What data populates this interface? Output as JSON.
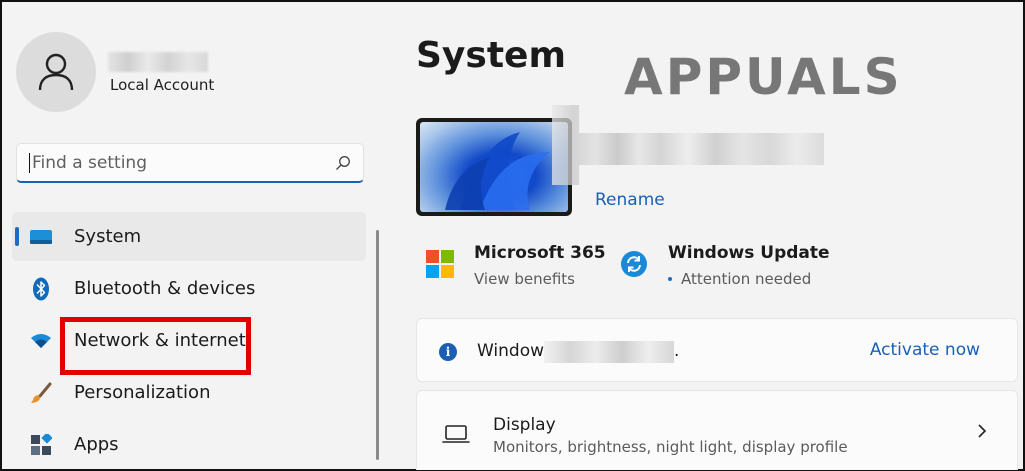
{
  "sidebar": {
    "account_type": "Local Account",
    "search_placeholder": "Find a setting",
    "items": [
      {
        "label": "System",
        "icon": "system-icon",
        "active": true
      },
      {
        "label": "Bluetooth & devices",
        "icon": "bluetooth-icon"
      },
      {
        "label": "Network & internet",
        "icon": "wifi-icon",
        "highlighted": true
      },
      {
        "label": "Personalization",
        "icon": "brush-icon"
      },
      {
        "label": "Apps",
        "icon": "apps-icon"
      }
    ]
  },
  "main": {
    "title": "System",
    "watermark": "APPUALS",
    "device": {
      "rename_label": "Rename"
    },
    "tiles": [
      {
        "title": "Microsoft 365",
        "subtitle": "View benefits",
        "icon": "microsoft-logo-icon"
      },
      {
        "title": "Windows Update",
        "subtitle": "Attention needed",
        "icon": "windows-update-icon"
      }
    ],
    "activation": {
      "text": "Window",
      "text_end": ".",
      "action": "Activate now"
    },
    "display": {
      "title": "Display",
      "subtitle": "Monitors, brightness, night light, display profile"
    }
  },
  "colors": {
    "accent": "#1a5fb4",
    "highlight": "#e30000",
    "background": "#f3f3f3"
  }
}
